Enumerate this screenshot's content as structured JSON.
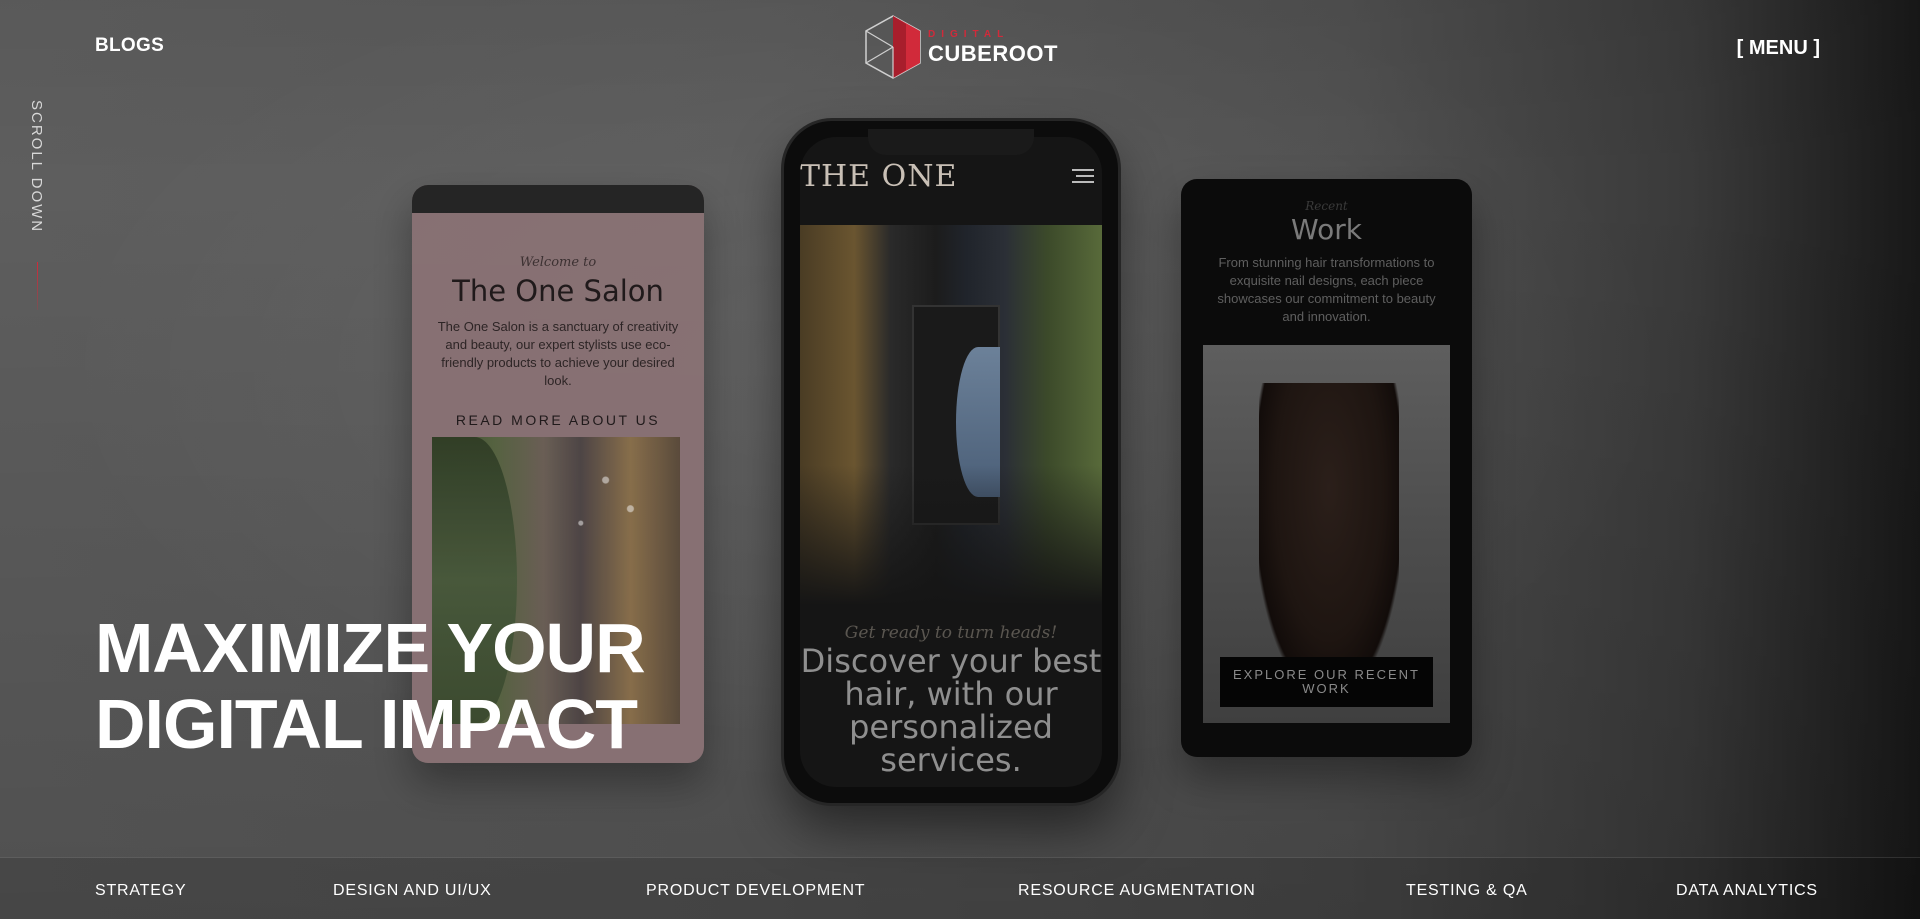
{
  "header": {
    "blogs_label": "BLOGS",
    "menu_label": "[ MENU ]",
    "logo": {
      "sub": "DIGITAL",
      "main": "CUBEROOT"
    }
  },
  "sidebar": {
    "scroll_label": "SCROLL DOWN"
  },
  "hero": {
    "title": "MAXIMIZE YOUR\nDIGITAL IMPACT"
  },
  "mockups": {
    "left": {
      "script": "Welcome to",
      "title": "The One Salon",
      "desc": "The One Salon is a sanctuary of creativity and beauty, our expert stylists use eco-friendly products to achieve your desired look.",
      "cta": "READ MORE ABOUT US"
    },
    "center": {
      "brand": "THE ONE",
      "tagline": "Get ready to turn heads!",
      "heading": "Discover your best hair, with our personalized services."
    },
    "right": {
      "script": "Recent",
      "title": "Work",
      "desc": "From stunning hair transformations to exquisite nail designs, each piece showcases our commitment to beauty and innovation.",
      "button": "EXPLORE OUR RECENT WORK"
    }
  },
  "bottom_nav": [
    {
      "label": "STRATEGY"
    },
    {
      "label": "DESIGN AND UI/UX"
    },
    {
      "label": "PRODUCT DEVELOPMENT"
    },
    {
      "label": "RESOURCE AUGMENTATION"
    },
    {
      "label": "TESTING & QA"
    },
    {
      "label": "DATA ANALYTICS"
    }
  ],
  "colors": {
    "accent": "#d12a3a",
    "text": "#ffffff"
  }
}
